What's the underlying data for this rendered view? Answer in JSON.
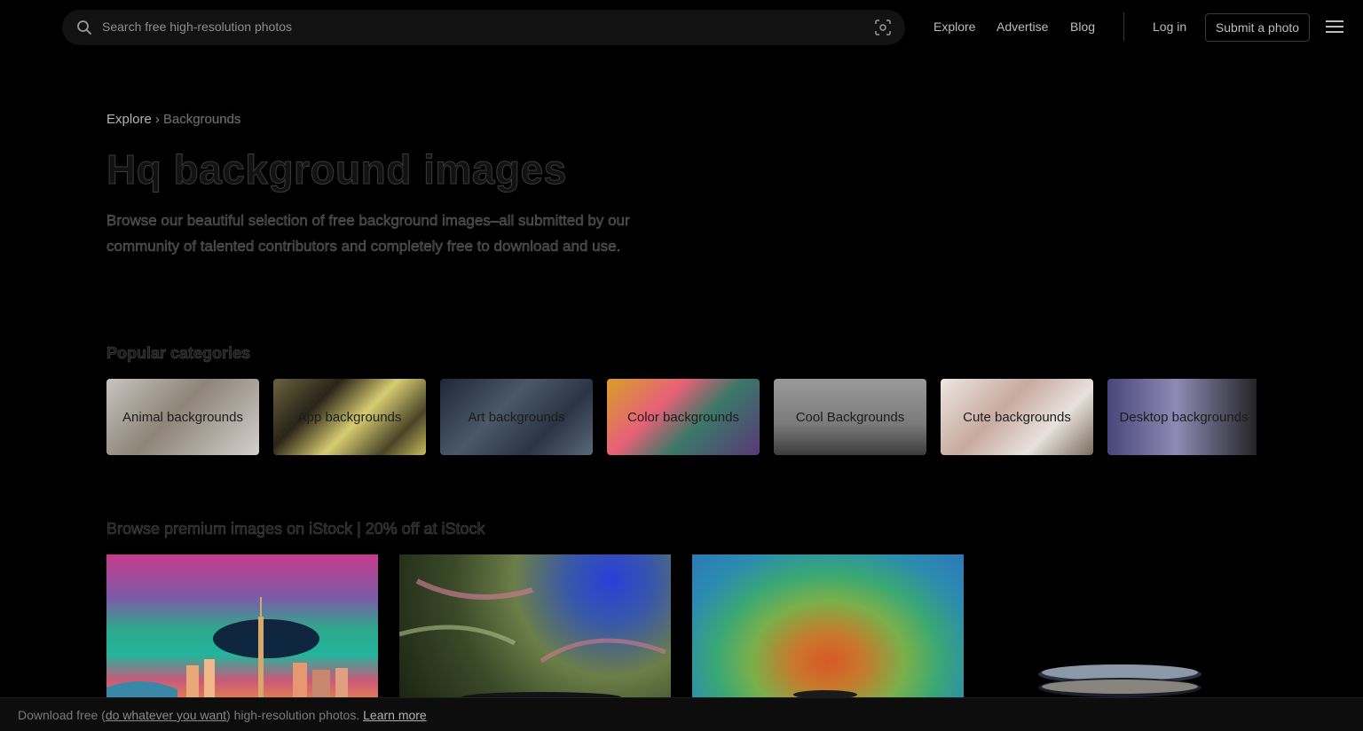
{
  "search": {
    "placeholder": "Search free high-resolution photos"
  },
  "nav": {
    "explore": "Explore",
    "advertise": "Advertise",
    "blog": "Blog",
    "login": "Log in",
    "submit": "Submit a photo"
  },
  "breadcrumb": {
    "root": "Explore",
    "sep": "›",
    "current": "Backgrounds"
  },
  "hero": {
    "title": "Hq background images",
    "desc": "Browse our beautiful selection of free background images–all submitted by our community of talented contributors and completely free to download and use."
  },
  "categories": {
    "heading": "Popular categories",
    "items": [
      {
        "label": "Animal backgrounds",
        "bg": "linear-gradient(135deg,#c8c4be 0%,#8e8478 45%,#d4d0cc 100%)"
      },
      {
        "label": "App backgrounds",
        "bg": "linear-gradient(135deg,#6a6240 0%,#2a2418 30%,#d8cc70 55%,#4a4428 80%,#c8bc58 100%)"
      },
      {
        "label": "Art backgrounds",
        "bg": "linear-gradient(135deg,#1e2838 0%,#4a5868 40%,#2a3444 70%,#5a6878 100%)"
      },
      {
        "label": "Color backgrounds",
        "bg": "linear-gradient(135deg,#d8a028 0%,#e86078 35%,#3a7868 60%,#5a3878 100%)"
      },
      {
        "label": "Cool Backgrounds",
        "bg": "linear-gradient(180deg,#9a9a9a 0%,#7a7a7a 60%,#3c3c3c 100%)"
      },
      {
        "label": "Cute backgrounds",
        "bg": "linear-gradient(135deg,#ece6e0 0%,#c8aaa0 40%,#e8e2dc 70%,#7a6c60 100%)"
      },
      {
        "label": "Desktop backgrounds",
        "bg": "linear-gradient(90deg,#48467a 0%,#8e8ab4 45%,#202020 100%)"
      }
    ]
  },
  "premium": {
    "heading": "Browse premium images on iStock | 20% off at iStock"
  },
  "footer": {
    "prefix": "Download free (",
    "link1": "do whatever you want",
    "middle": ") high-resolution photos.",
    "learn": "Learn more"
  }
}
